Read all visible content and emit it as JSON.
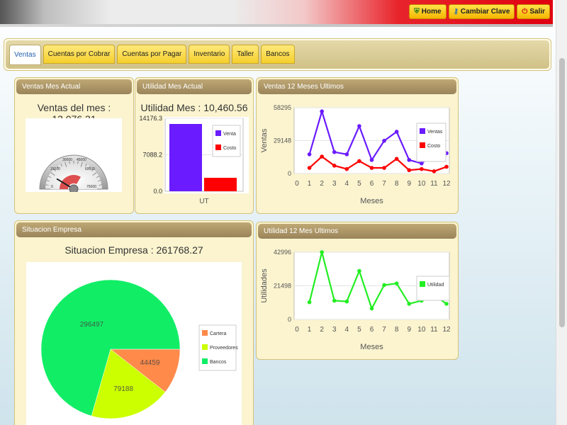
{
  "topnav": {
    "home_label": "Home",
    "change_password_label": "Cambiar Clave",
    "logout_label": "Salir"
  },
  "tabs": [
    {
      "label": "Ventas",
      "active": true
    },
    {
      "label": "Cuentas por Cobrar"
    },
    {
      "label": "Cuentas por Pagar"
    },
    {
      "label": "Inventario"
    },
    {
      "label": "Taller"
    },
    {
      "label": "Bancos"
    }
  ],
  "panels": {
    "sales_month": {
      "header": "Ventas Mes Actual",
      "title": "Ventas del mes : 13,076.31",
      "gauge": {
        "labels": [
          "0",
          "15000",
          "30000",
          "45000",
          "60000",
          "75000"
        ],
        "value": 13076.31
      }
    },
    "profit_month": {
      "header": "Utilidad Mes Actual",
      "title": "Utilidad Mes : 10,460.56"
    },
    "sales_12": {
      "header": "Ventas 12 Meses Ultimos"
    },
    "situation": {
      "header": "Situacion Empresa",
      "title": "Situacion Empresa : 261768.27"
    },
    "profit_12": {
      "header": "Utilidad 12 Mes Ultimos"
    }
  },
  "chart_data": [
    {
      "type": "bar",
      "categories": [
        "UT"
      ],
      "series": [
        {
          "name": "Venta",
          "values": [
            13076.31
          ],
          "color": "#6a1bff"
        },
        {
          "name": "Costo",
          "values": [
            2615.75
          ],
          "color": "#ff0000"
        }
      ],
      "yticks": [
        "0.0",
        "7088.2",
        "14176.3"
      ],
      "ylim": [
        0,
        14176.3
      ],
      "legend": "top-right"
    },
    {
      "type": "line",
      "x": [
        1,
        2,
        3,
        4,
        5,
        6,
        7,
        8,
        9,
        10,
        11,
        12
      ],
      "series": [
        {
          "name": "Ventas",
          "values": [
            17000,
            55000,
            19000,
            17000,
            42000,
            12000,
            29000,
            37000,
            12000,
            9000,
            18000,
            18000
          ],
          "color": "#6a1bff"
        },
        {
          "name": "Costo",
          "values": [
            5000,
            15000,
            7000,
            4000,
            11000,
            5000,
            5000,
            13000,
            3000,
            4000,
            2000,
            6000
          ],
          "color": "#ff0000"
        }
      ],
      "ylabel": "Ventas",
      "xlabel": "Meses",
      "yticks": [
        "0",
        "29148",
        "58295"
      ],
      "ylim": [
        0,
        58295
      ],
      "legend": "right"
    },
    {
      "type": "line",
      "x": [
        1,
        2,
        3,
        4,
        5,
        6,
        7,
        8,
        9,
        10,
        11,
        12
      ],
      "series": [
        {
          "name": "Utilidad",
          "values": [
            11000,
            42996,
            12000,
            11500,
            31000,
            7000,
            22000,
            23000,
            10000,
            12000,
            15500,
            10000
          ],
          "color": "#22ee22"
        }
      ],
      "ylabel": "Utilidades",
      "xlabel": "Meses",
      "yticks": [
        "0",
        "21498",
        "42996"
      ],
      "ylim": [
        0,
        42996
      ],
      "legend": "right"
    },
    {
      "type": "pie",
      "slices": [
        {
          "name": "Cartera",
          "value": 44459,
          "color": "#ff8a4a"
        },
        {
          "name": "Proveedores",
          "value": 79188,
          "color": "#ccff00"
        },
        {
          "name": "Bancos",
          "value": 296497,
          "color": "#11ee66"
        }
      ],
      "legend": "right"
    }
  ]
}
